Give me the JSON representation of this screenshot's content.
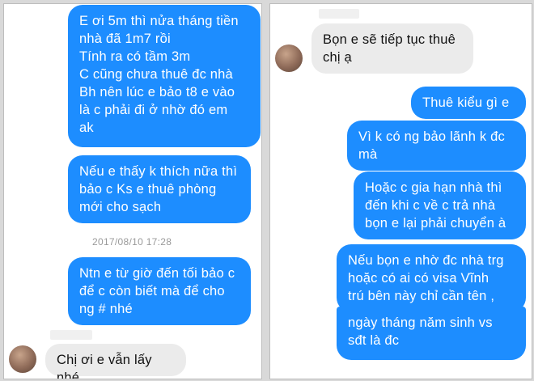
{
  "left": {
    "messages": [
      "E ơi 5m thì nửa tháng tiền\nnhà đã 1m7 rồi\nTính ra có tầm 3m\nC cũng chưa thuê đc nhà\nBh nên lúc e bảo t8 e vào\nlà c phải đi ở nhờ đó em\nak",
      "Nếu e thấy k thích nữa thì\nbảo c Ks e thuê phòng\nmới cho sạch",
      "Ntn e từ giờ đến tối bảo c\nđể c còn biết mà để cho\nng # nhé"
    ],
    "timestamp": "2017/08/10 17:28",
    "incoming": "Chị ơi e vẫn lấy nhé"
  },
  "right": {
    "incoming": "Bọn e sẽ tiếp tục thuê\nchị ạ",
    "messages": [
      "Thuê kiểu gì e",
      "Vì k có ng bảo lãnh k đc\nmà",
      "Hoặc c gia hạn nhà thì\nđến khi c về c trả nhà\nbọn e lại phải chuyển à",
      "Nếu bọn e nhờ đc nhà trg\nhoặc có ai có visa Vĩnh\ntrú bên này chỉ cần tên ,",
      "ngày tháng năm sinh vs\nsđt là đc"
    ]
  },
  "colors": {
    "outgoing": "#1d8dff",
    "incoming": "#ebebeb",
    "background": "#ffffff"
  }
}
